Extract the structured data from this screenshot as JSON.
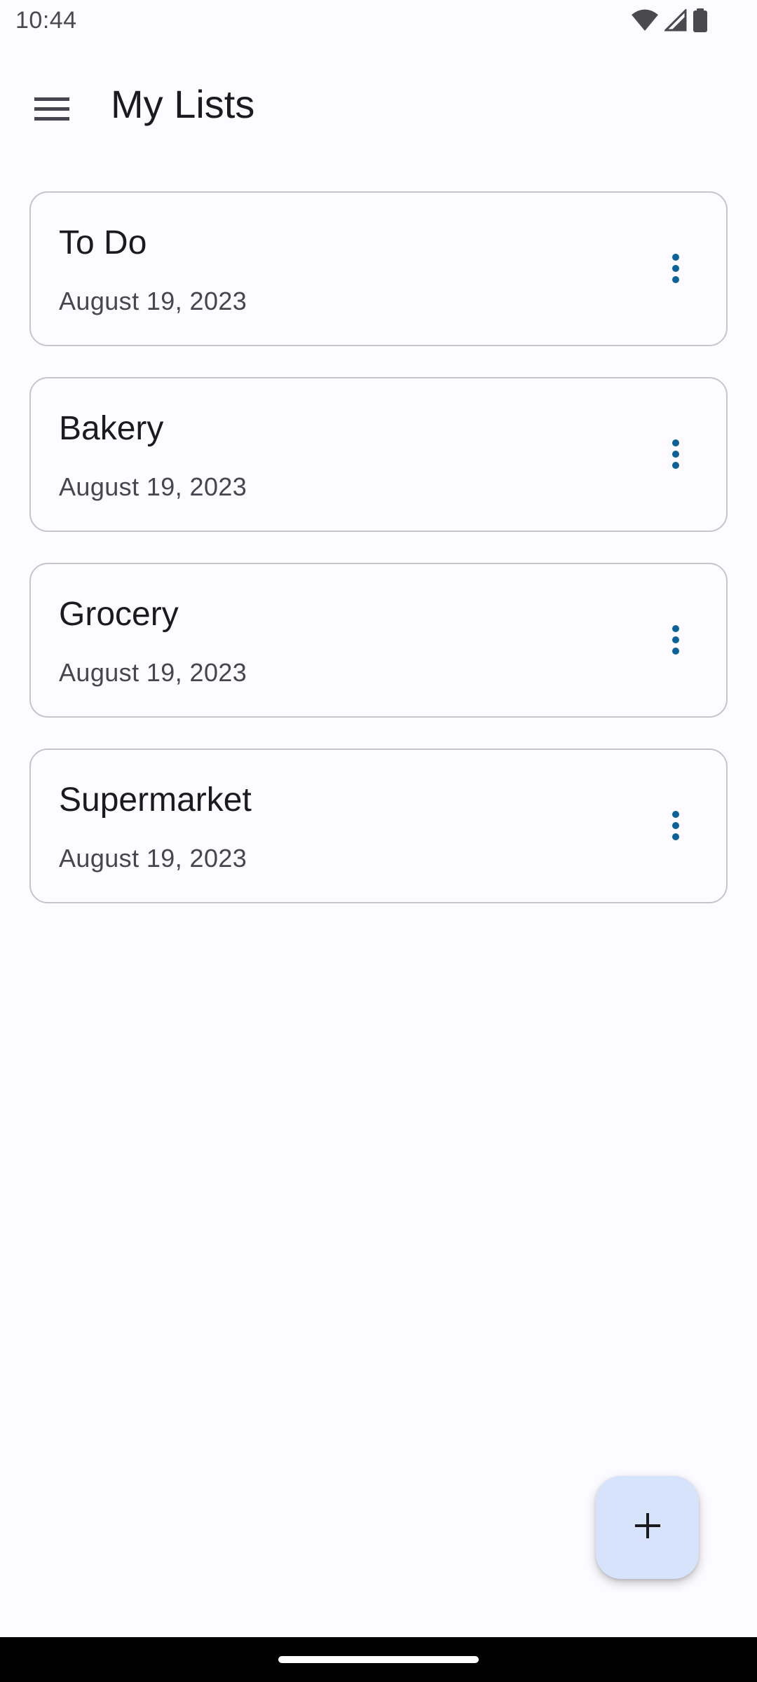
{
  "status_bar": {
    "time": "10:44",
    "icons": [
      "wifi-icon",
      "signal-icon",
      "battery-icon"
    ]
  },
  "app_bar": {
    "title": "My Lists",
    "menu_icon": "hamburger-menu-icon"
  },
  "lists": [
    {
      "title": "To Do",
      "date": "August 19, 2023"
    },
    {
      "title": "Bakery",
      "date": "August 19, 2023"
    },
    {
      "title": "Grocery",
      "date": "August 19, 2023"
    },
    {
      "title": "Supermarket",
      "date": "August 19, 2023"
    }
  ],
  "fab": {
    "icon": "plus-icon"
  },
  "colors": {
    "background": "#fcfbff",
    "accent": "#0b629b",
    "fab_background": "#d7e3fb",
    "card_border": "#c6c5cc"
  }
}
